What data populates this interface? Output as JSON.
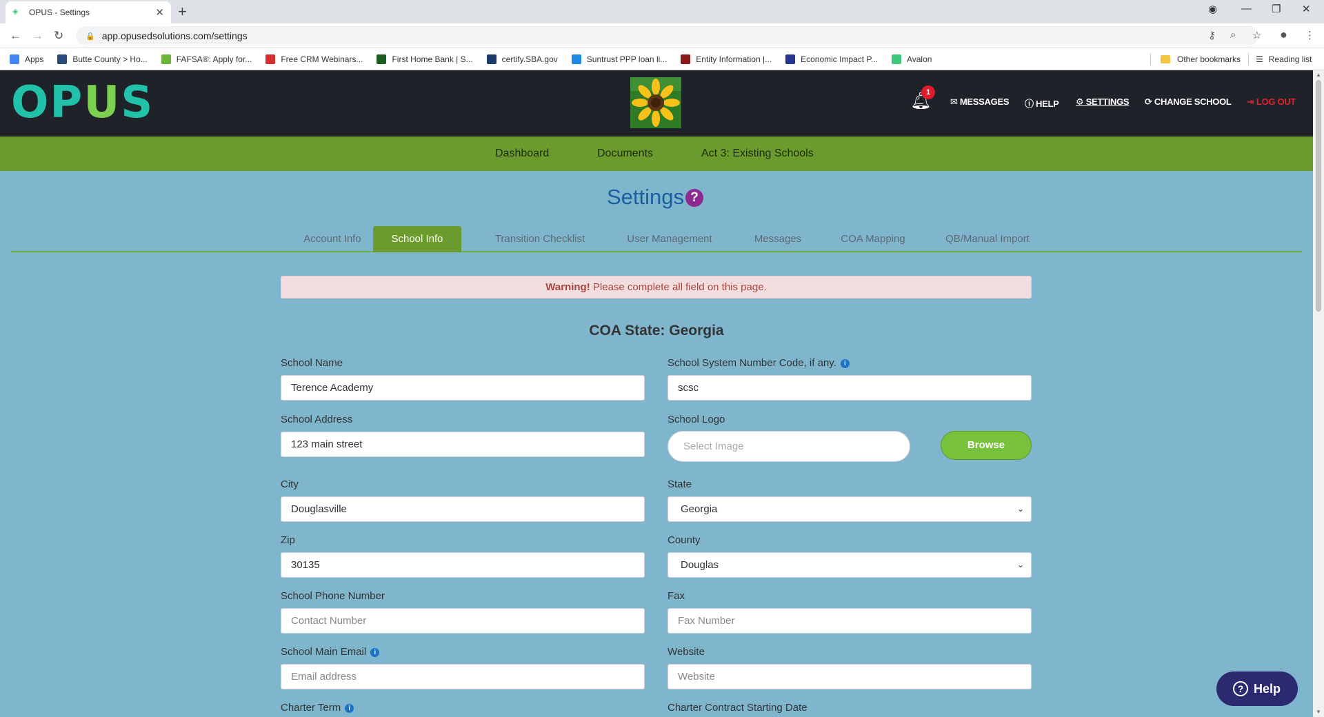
{
  "browser": {
    "tab_title": "OPUS - Settings",
    "new_tab": "+",
    "url": "app.opusedsolutions.com/settings",
    "bookmarks": [
      {
        "label": "Apps",
        "color": "#4285f4"
      },
      {
        "label": "Butte County > Ho...",
        "color": "#2a4a7a"
      },
      {
        "label": "FAFSA®: Apply for...",
        "color": "#6bb536"
      },
      {
        "label": "Free CRM Webinars...",
        "color": "#d32f2f"
      },
      {
        "label": "First Home Bank | S...",
        "color": "#1b5e20"
      },
      {
        "label": "certify.SBA.gov",
        "color": "#1a3a6b"
      },
      {
        "label": "Suntrust PPP loan li...",
        "color": "#1e88e5"
      },
      {
        "label": "Entity Information |...",
        "color": "#8b1a1a"
      },
      {
        "label": "Economic Impact P...",
        "color": "#283593"
      },
      {
        "label": "Avalon",
        "color": "#3ec67b"
      }
    ],
    "other_bookmarks": "Other bookmarks",
    "reading_list": "Reading list"
  },
  "header": {
    "logo_letters": [
      "OP",
      "U",
      "S"
    ],
    "notification_count": "1",
    "links": {
      "messages": "MESSAGES",
      "help": "HELP",
      "settings": "SETTINGS",
      "change_school": "CHANGE SCHOOL",
      "logout": "LOG OUT"
    }
  },
  "main_nav": [
    "Dashboard",
    "Documents",
    "Act 3: Existing Schools"
  ],
  "page": {
    "title": "Settings",
    "help_glyph": "?",
    "tabs": [
      "Account Info",
      "School Info",
      "Transition Checklist",
      "User Management",
      "Messages",
      "COA Mapping",
      "QB/Manual Import"
    ],
    "active_tab": "School Info",
    "warning_strong": "Warning!",
    "warning_text": "Please complete all field on this page.",
    "coa_state": "COA State: Georgia"
  },
  "form": {
    "school_name": {
      "label": "School Name",
      "value": "Terence Academy"
    },
    "system_code": {
      "label": "School System Number Code, if any.",
      "value": "scsc"
    },
    "address": {
      "label": "School Address",
      "value": "123 main street"
    },
    "logo": {
      "label": "School Logo",
      "placeholder": "Select Image",
      "button": "Browse"
    },
    "city": {
      "label": "City",
      "value": "Douglasville"
    },
    "state": {
      "label": "State",
      "value": "Georgia"
    },
    "zip": {
      "label": "Zip",
      "value": "30135"
    },
    "county": {
      "label": "County",
      "value": "Douglas"
    },
    "phone": {
      "label": "School Phone Number",
      "placeholder": "Contact Number"
    },
    "fax": {
      "label": "Fax",
      "placeholder": "Fax Number"
    },
    "email": {
      "label": "School Main Email",
      "placeholder": "Email address"
    },
    "website": {
      "label": "Website",
      "placeholder": "Website"
    },
    "charter_term": {
      "label": "Charter Term"
    },
    "charter_start": {
      "label": "Charter Contract Starting Date"
    }
  },
  "help_widget": {
    "label": "Help"
  }
}
